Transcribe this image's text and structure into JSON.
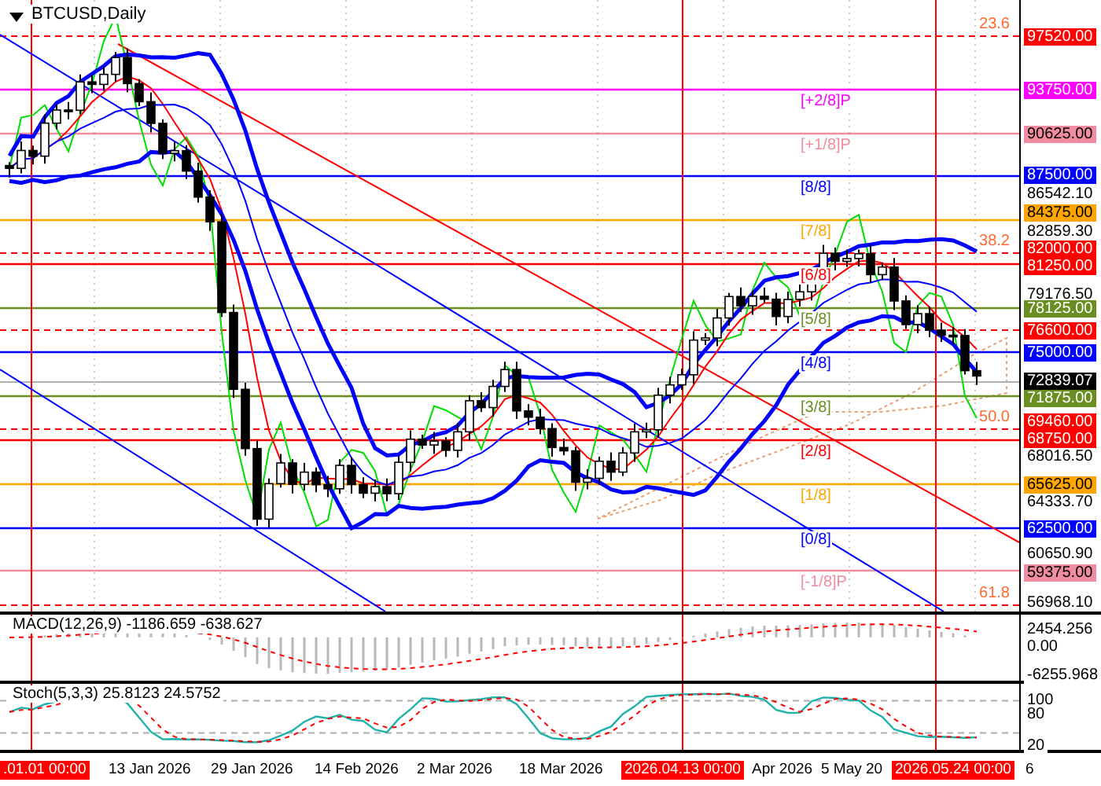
{
  "chart_title": "BTCUSD,Daily",
  "price_axis": [
    {
      "text": "97520.00",
      "color": "#ff0000"
    },
    {
      "text": "93750.00",
      "color": "#ff00ff"
    },
    {
      "text": "90625.00",
      "color": "#f08ca0"
    },
    {
      "text": "87500.00",
      "color": "#0000ff"
    },
    {
      "text": "86542.10"
    },
    {
      "text": "84375.00",
      "color": "#ffa500"
    },
    {
      "text": "82859.30"
    },
    {
      "text": "82000.00",
      "color": "#ff0000"
    },
    {
      "text": "81250.00",
      "color": "#ff0000"
    },
    {
      "text": "79176.50"
    },
    {
      "text": "78125.00",
      "color": "#6b8e23"
    },
    {
      "text": "76600.00",
      "color": "#ff0000"
    },
    {
      "text": "75000.00",
      "color": "#0000ff"
    },
    {
      "text": "72839.07",
      "color": "#000000"
    },
    {
      "text": "71875.00",
      "color": "#6b8e23"
    },
    {
      "text": "69460.00",
      "color": "#ff0000"
    },
    {
      "text": "68750.00",
      "color": "#ff0000"
    },
    {
      "text": "68016.50"
    },
    {
      "text": "65625.00",
      "color": "#ffa500"
    },
    {
      "text": "64333.70"
    },
    {
      "text": "62500.00",
      "color": "#0000ff"
    },
    {
      "text": "60650.90"
    },
    {
      "text": "59375.00",
      "color": "#f08ca0"
    },
    {
      "text": "56968.10"
    }
  ],
  "murrey_levels": [
    {
      "label": "[+2/8]P",
      "color": "#ff00ff"
    },
    {
      "label": "[+1/8]P",
      "color": "#f08ca0"
    },
    {
      "label": "[8/8]",
      "color": "#0000ff"
    },
    {
      "label": "[7/8]",
      "color": "#ffa500"
    },
    {
      "label": "[6/8]",
      "color": "#ff0000"
    },
    {
      "label": "[5/8]",
      "color": "#6b8e23"
    },
    {
      "label": "[4/8]",
      "color": "#0000ff"
    },
    {
      "label": "[3/8]",
      "color": "#6b8e23"
    },
    {
      "label": "[2/8]",
      "color": "#ff0000"
    },
    {
      "label": "[1/8]",
      "color": "#ffa500"
    },
    {
      "label": "[0/8]",
      "color": "#0000ff"
    },
    {
      "label": "[-1/8]P",
      "color": "#f08ca0"
    }
  ],
  "fibonacci_levels": [
    "23.6",
    "38.2",
    "50.0",
    "61.8"
  ],
  "macd": {
    "label": "MACD(12,26,9) -1186.659 -638.627",
    "axis": [
      "2454.256",
      "0.00",
      "-6255.968"
    ]
  },
  "stochastic": {
    "label": "Stoch(5,3,3) 25.8123 24.5752",
    "axis": [
      "100",
      "80",
      "20"
    ]
  },
  "time_axis": [
    {
      "text": ".01.01 00:00",
      "kind": "cursor"
    },
    {
      "text": "13 Jan 2026",
      "kind": "date"
    },
    {
      "text": "29 Jan 2026",
      "kind": "date"
    },
    {
      "text": "14 Feb 2026",
      "kind": "date"
    },
    {
      "text": "2 Mar 2026",
      "kind": "date"
    },
    {
      "text": "18 Mar 2026",
      "kind": "date"
    },
    {
      "text": "2026.04.13 00:00",
      "kind": "cursor"
    },
    {
      "text": "Apr 2026",
      "kind": "date"
    },
    {
      "text": "5 May 20",
      "kind": "date"
    },
    {
      "text": "2026.05.24 00:00",
      "kind": "cursor"
    },
    {
      "text": "6",
      "kind": "date"
    }
  ]
}
